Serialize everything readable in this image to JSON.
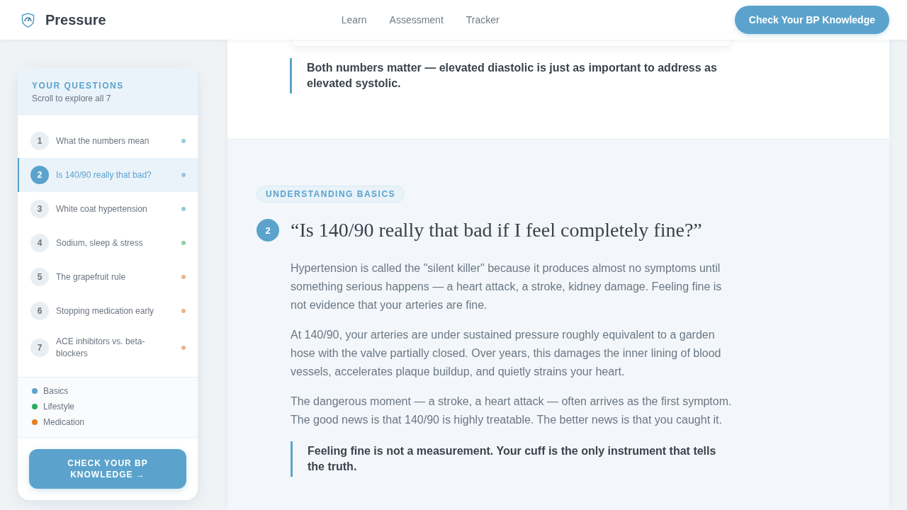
{
  "header": {
    "brand": "Pressure",
    "nav": [
      "Learn",
      "Assessment",
      "Tracker"
    ],
    "cta": "Check Your BP Knowledge"
  },
  "sidebar": {
    "title": "YOUR QUESTIONS",
    "subtitle": "Scroll to explore all 7",
    "items": [
      {
        "number": "1",
        "label": "What the numbers mean",
        "color": "#95c8de",
        "selected": false
      },
      {
        "number": "2",
        "label": "Is 140/90 really that bad?",
        "color": "#95c8de",
        "selected": true
      },
      {
        "number": "3",
        "label": "White coat hypertension",
        "color": "#95c8de",
        "selected": false
      },
      {
        "number": "4",
        "label": "Sodium, sleep & stress",
        "color": "#8ccfa8",
        "selected": false
      },
      {
        "number": "5",
        "label": "The grapefruit rule",
        "color": "#ebb48a",
        "selected": false
      },
      {
        "number": "6",
        "label": "Stopping medication early",
        "color": "#ebb48a",
        "selected": false
      },
      {
        "number": "7",
        "label": "ACE inhibitors vs. beta-blockers",
        "color": "#ebb48a",
        "selected": false
      }
    ],
    "legend": [
      {
        "label": "Basics",
        "color": "#5ba3cc"
      },
      {
        "label": "Lifestyle",
        "color": "#27ae60"
      },
      {
        "label": "Medication",
        "color": "#e67e22"
      }
    ],
    "button": "CHECK YOUR BP KNOWLEDGE →"
  },
  "previous_section": {
    "callout": "Both numbers matter — elevated diastolic is just as important to address as elevated systolic."
  },
  "section": {
    "tag": "UNDERSTANDING BASICS",
    "number": "2",
    "title": "“Is 140/90 really that bad if I feel completely fine?”",
    "paragraphs": [
      "Hypertension is called the \"silent killer\" because it produces almost no symptoms until something serious happens — a heart attack, a stroke, kidney damage. Feeling fine is not evidence that your arteries are fine.",
      "At 140/90, your arteries are under sustained pressure roughly equivalent to a garden hose with the valve partially closed. Over years, this damages the inner lining of blood vessels, accelerates plaque buildup, and quietly strains your heart.",
      "The dangerous moment — a stroke, a heart attack — often arrives as the first symptom. The good news is that 140/90 is highly treatable. The better news is that you caught it."
    ],
    "callout": "Feeling fine is not a measurement. Your cuff is the only instrument that tells the truth."
  }
}
